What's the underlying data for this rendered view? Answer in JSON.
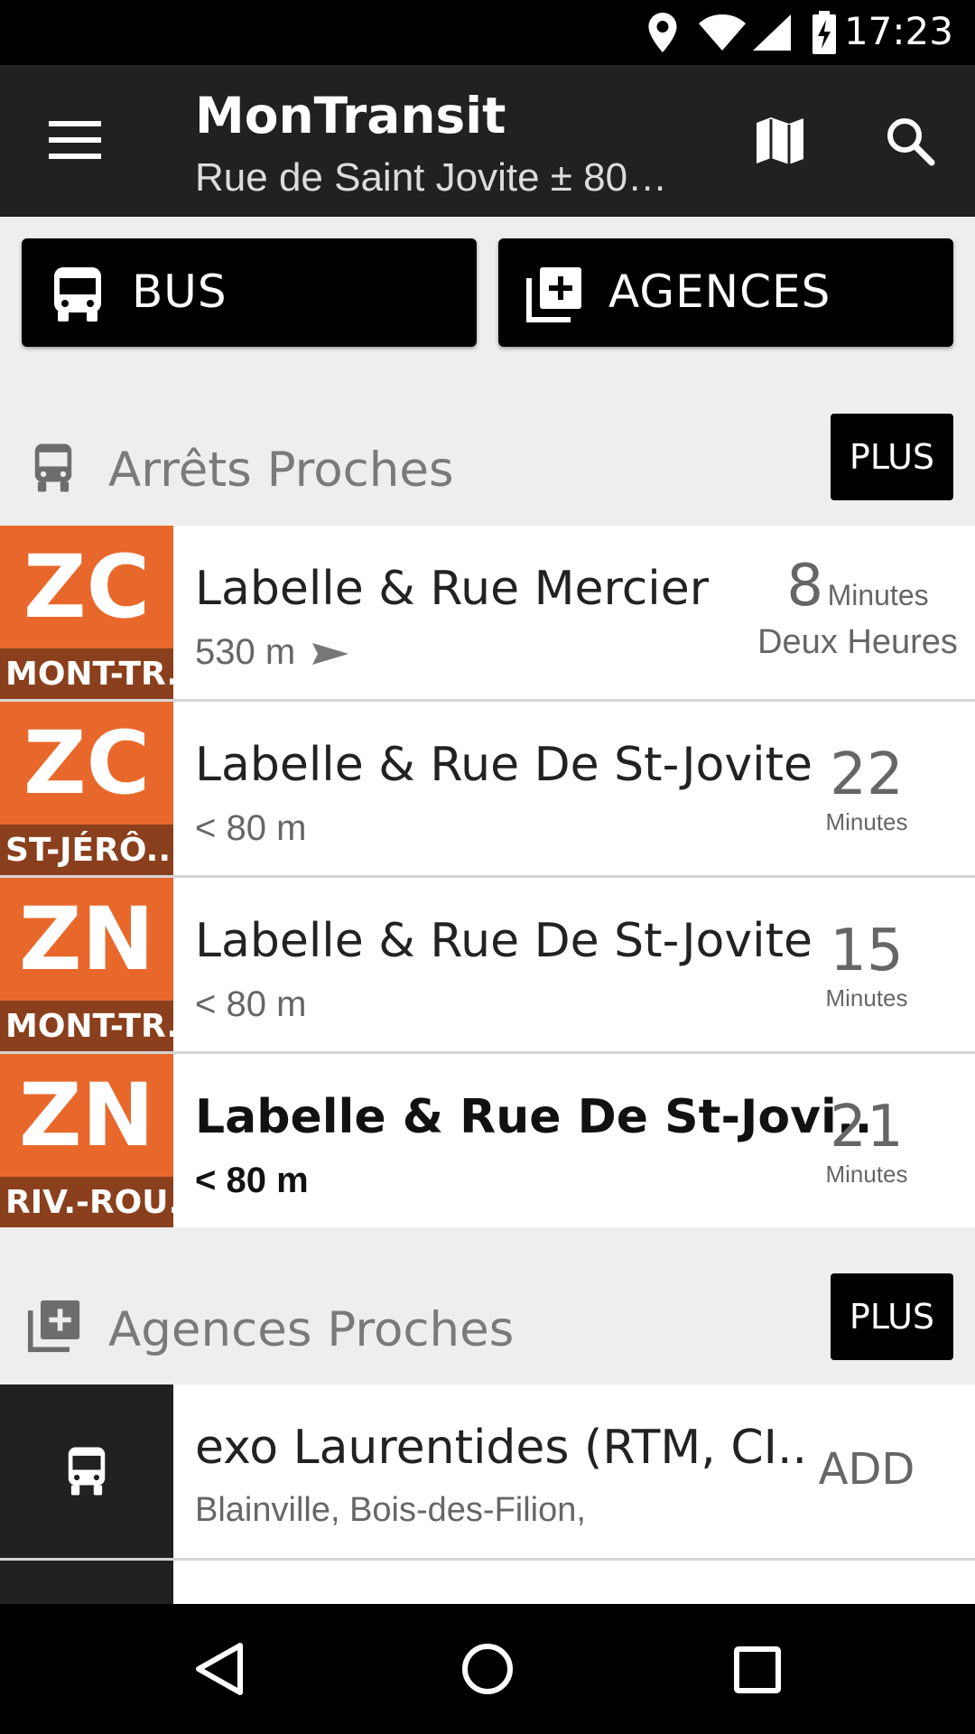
{
  "status_bar": {
    "time": "17:23"
  },
  "toolbar": {
    "title": "MonTransit",
    "subtitle": "Rue de Saint Jovite ± 80…"
  },
  "filters": [
    {
      "label": "BUS",
      "icon": "bus-icon"
    },
    {
      "label": "AGENCES",
      "icon": "add-library-icon"
    }
  ],
  "nearby_stops": {
    "title": "Arrêts Proches",
    "more_label": "PLUS",
    "items": [
      {
        "route": "ZC",
        "direction": "MONT-TR..",
        "name": "Labelle & Rue Mercier",
        "distance": "530 m",
        "eta_value": "8",
        "eta_unit": "Minutes",
        "eta_extra": "Deux Heures"
      },
      {
        "route": "ZC",
        "direction": "ST-JÉRÔ..",
        "name": "Labelle & Rue De St-Jovite",
        "distance": "< 80 m",
        "eta_value": "22",
        "eta_unit": "Minutes"
      },
      {
        "route": "ZN",
        "direction": "MONT-TR..",
        "name": "Labelle & Rue De St-Jovite",
        "distance": "< 80 m",
        "eta_value": "15",
        "eta_unit": "Minutes"
      },
      {
        "route": "ZN",
        "direction": "RIV.-ROU..",
        "name": "Labelle & Rue De St-Jovi..",
        "distance": "< 80 m",
        "eta_value": "21",
        "eta_unit": "Minutes"
      }
    ]
  },
  "nearby_agencies": {
    "title": "Agences Proches",
    "more_label": "PLUS",
    "items": [
      {
        "name": "exo Laurentides (RTM, CI..",
        "locations": "Blainville, Bois-des-Filion,",
        "action": "ADD"
      }
    ]
  },
  "colors": {
    "route_bg": "#e8682b",
    "route_dir_bg": "#8a3f1d",
    "toolbar": "#212121"
  }
}
